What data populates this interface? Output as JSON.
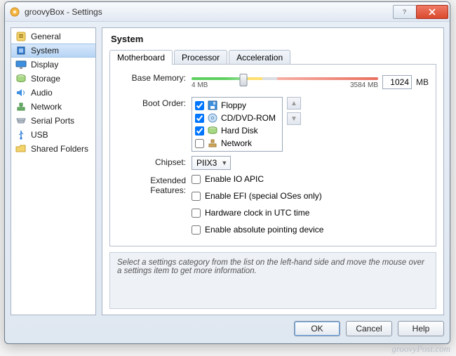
{
  "window": {
    "title": "groovyBox - Settings",
    "faint_subtitle": ""
  },
  "sidebar": {
    "items": [
      {
        "label": "General",
        "icon": "settings-icon"
      },
      {
        "label": "System",
        "icon": "chip-icon"
      },
      {
        "label": "Display",
        "icon": "monitor-icon"
      },
      {
        "label": "Storage",
        "icon": "disk-icon"
      },
      {
        "label": "Audio",
        "icon": "audio-icon"
      },
      {
        "label": "Network",
        "icon": "network-icon"
      },
      {
        "label": "Serial Ports",
        "icon": "serial-icon"
      },
      {
        "label": "USB",
        "icon": "usb-icon"
      },
      {
        "label": "Shared Folders",
        "icon": "folder-icon"
      }
    ],
    "active_index": 1
  },
  "page": {
    "heading": "System",
    "tabs": [
      {
        "label": "Motherboard"
      },
      {
        "label": "Processor"
      },
      {
        "label": "Acceleration"
      }
    ],
    "active_tab": 0,
    "base_memory": {
      "label": "Base Memory:",
      "value": "1024",
      "unit": "MB",
      "min_label": "4 MB",
      "max_label": "3584 MB"
    },
    "boot_order": {
      "label": "Boot Order:",
      "items": [
        {
          "label": "Floppy",
          "checked": true,
          "icon": "floppy-icon"
        },
        {
          "label": "CD/DVD-ROM",
          "checked": true,
          "icon": "disc-icon"
        },
        {
          "label": "Hard Disk",
          "checked": true,
          "icon": "harddisk-icon"
        },
        {
          "label": "Network",
          "checked": false,
          "icon": "lan-icon"
        }
      ]
    },
    "chipset": {
      "label": "Chipset:",
      "value": "PIIX3"
    },
    "extended": {
      "label": "Extended Features:",
      "options": [
        {
          "label": "Enable IO APIC",
          "checked": false
        },
        {
          "label": "Enable EFI (special OSes only)",
          "checked": false
        },
        {
          "label": "Hardware clock in UTC time",
          "checked": false
        },
        {
          "label": "Enable absolute pointing device",
          "checked": false
        }
      ]
    },
    "hint": "Select a settings category from the list on the left-hand side and move the mouse over a settings item to get more information."
  },
  "footer": {
    "ok": "OK",
    "cancel": "Cancel",
    "help": "Help"
  },
  "watermark": "groovyPost.com"
}
